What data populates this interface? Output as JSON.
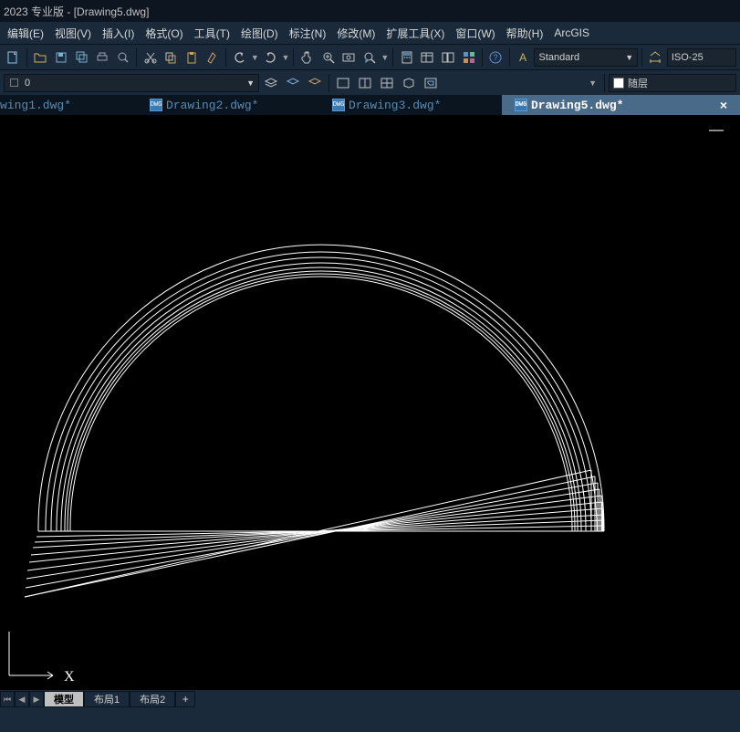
{
  "title": "2023 专业版 - [Drawing5.dwg]",
  "menus": {
    "edit": "编辑(E)",
    "view": "视图(V)",
    "insert": "插入(I)",
    "format": "格式(O)",
    "tools": "工具(T)",
    "draw": "绘图(D)",
    "dimension": "标注(N)",
    "modify": "修改(M)",
    "ext": "扩展工具(X)",
    "window": "窗口(W)",
    "help": "帮助(H)",
    "arcgis": "ArcGIS"
  },
  "dropdowns": {
    "text_style": "Standard",
    "dim_style": "ISO-25",
    "layer": "0",
    "color": "随层"
  },
  "icons": {
    "dwg": "DWG"
  },
  "doc_tabs": [
    {
      "label": "wing1.dwg*",
      "active": false
    },
    {
      "label": "Drawing2.dwg*",
      "active": false
    },
    {
      "label": "Drawing3.dwg*",
      "active": false
    },
    {
      "label": "Drawing5.dwg*",
      "active": true
    }
  ],
  "bottom_tabs": {
    "model": "模型",
    "layout1": "布局1",
    "layout2": "布局2",
    "add": "+"
  },
  "ucs": {
    "x": "X"
  }
}
